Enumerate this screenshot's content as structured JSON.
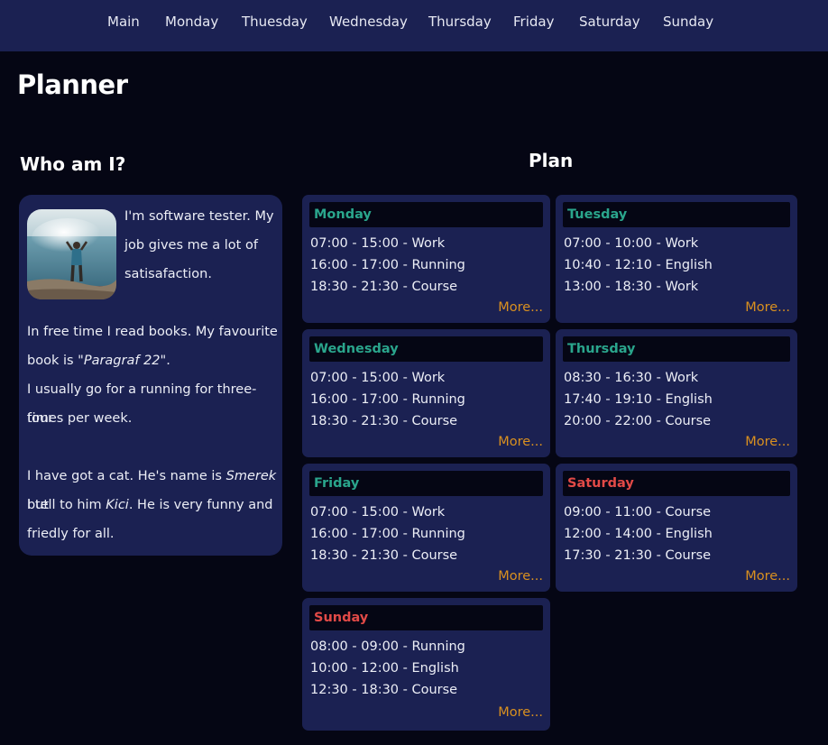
{
  "nav": {
    "items": [
      {
        "label": "Main"
      },
      {
        "label": "Monday"
      },
      {
        "label": "Thuesday"
      },
      {
        "label": "Wednesday"
      },
      {
        "label": "Thursday"
      },
      {
        "label": "Friday"
      },
      {
        "label": "Saturday"
      },
      {
        "label": "Sunday"
      }
    ]
  },
  "page_title": "Planner",
  "about": {
    "title": "Who am I?",
    "line1": "I'm software tester. My",
    "line2": "job gives me a lot of",
    "line3": "satisafaction.",
    "line4": "In free time I read books. My favourite",
    "line5_pre": "book is ",
    "line5_book": "\"Paragraf 22\"",
    "line5_post": ".",
    "line6": "I usually go for a running for three-four",
    "line7": "times per week.",
    "line8_pre": "I have got a cat. He's name is ",
    "line8_name": "Smerek",
    "line8_post": " but",
    "line9_pre": "I tell to him ",
    "line9_name": "Kici",
    "line9_post": ". He is very funny and",
    "line10": "friedly for all."
  },
  "plan": {
    "title": "Plan",
    "more_label": "More...",
    "days": [
      {
        "name": "Monday",
        "color": "#2aa58c",
        "entries": [
          "07:00 - 15:00 - Work",
          "16:00 - 17:00 - Running",
          "18:30 - 21:30 - Course"
        ]
      },
      {
        "name": "Tuesday",
        "color": "#2aa58c",
        "entries": [
          "07:00 - 10:00 - Work",
          "10:40 - 12:10 - English",
          "13:00 - 18:30 - Work"
        ]
      },
      {
        "name": "Wednesday",
        "color": "#2aa58c",
        "entries": [
          "07:00 - 15:00 - Work",
          "16:00 - 17:00 - Running",
          "18:30 - 21:30 - Course"
        ]
      },
      {
        "name": "Thursday",
        "color": "#2aa58c",
        "entries": [
          "08:30 - 16:30 - Work",
          "17:40 - 19:10 - English",
          "20:00 - 22:00 - Course"
        ]
      },
      {
        "name": "Friday",
        "color": "#2aa58c",
        "entries": [
          "07:00 - 15:00 - Work",
          "16:00 - 17:00 - Running",
          "18:30 - 21:30 - Course"
        ]
      },
      {
        "name": "Saturday",
        "color": "#e24a47",
        "entries": [
          "09:00 - 11:00 - Course",
          "12:00 - 14:00 - English",
          "17:30 - 21:30 - Course"
        ]
      },
      {
        "name": "Sunday",
        "color": "#e24a47",
        "entries": [
          "08:00 - 09:00 - Running",
          "10:00 - 12:00 - English",
          "12:30 - 18:30 - Course"
        ]
      }
    ]
  }
}
